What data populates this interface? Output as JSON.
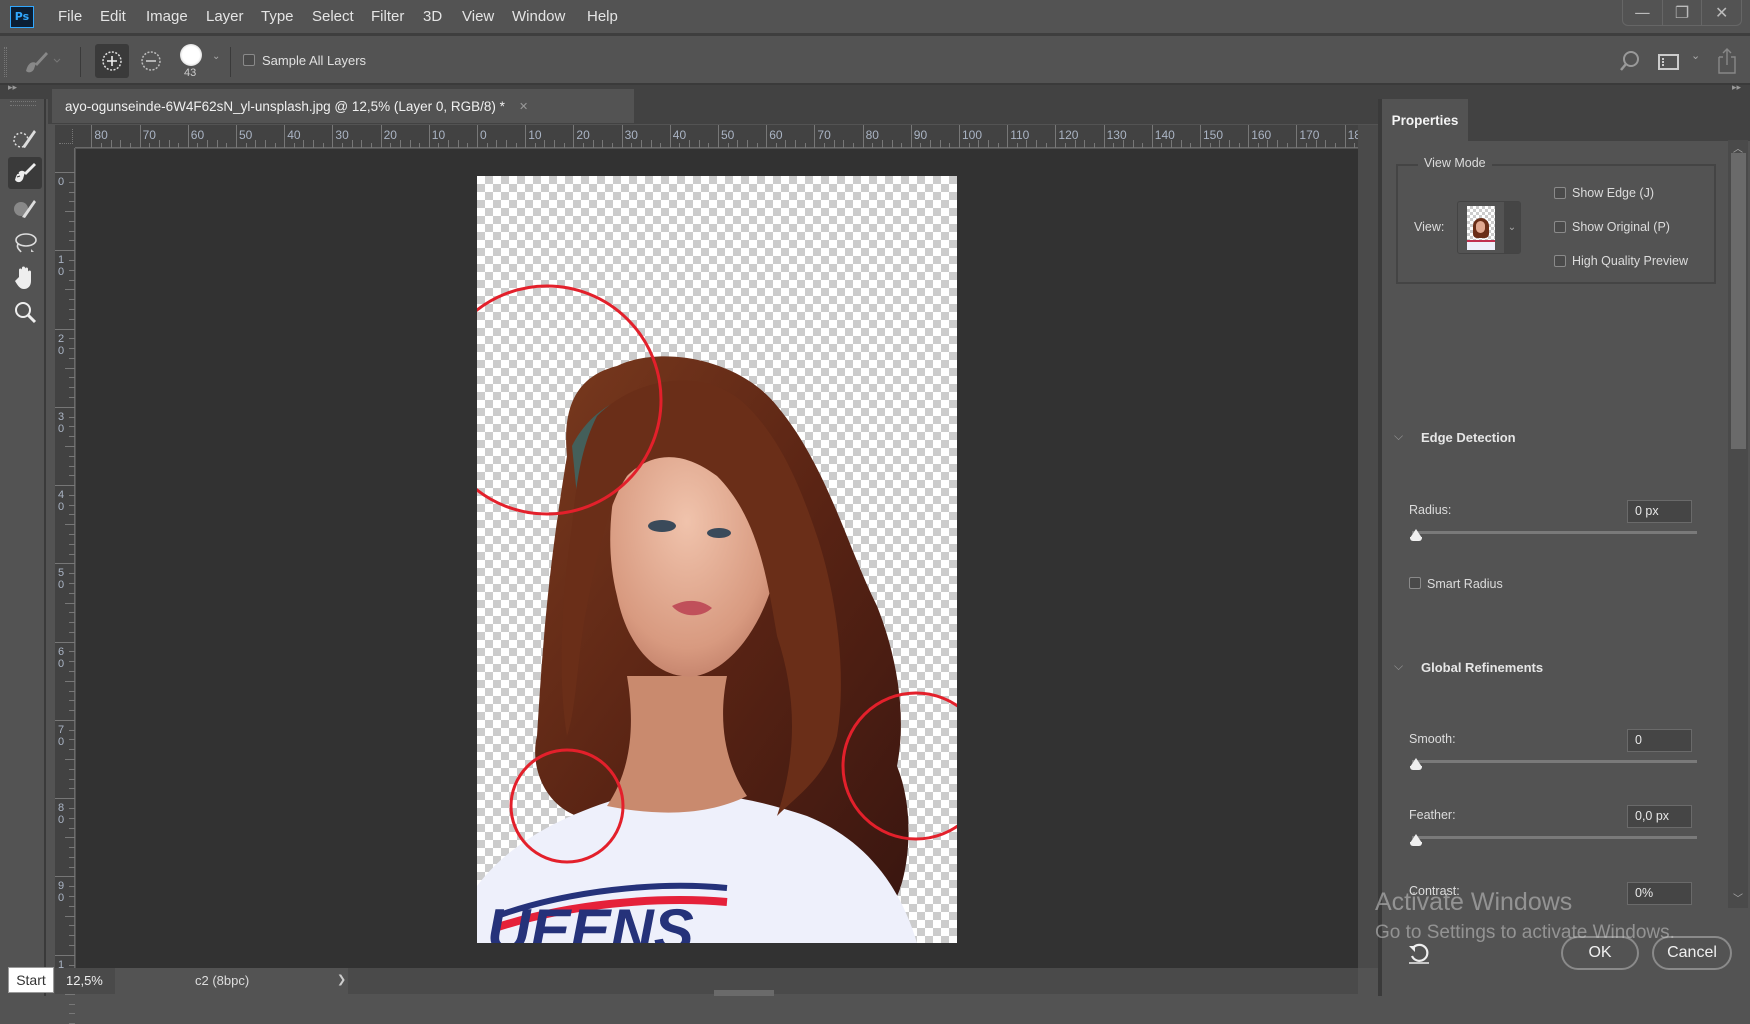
{
  "app": {
    "logo": "Ps"
  },
  "menu": [
    "File",
    "Edit",
    "Image",
    "Layer",
    "Type",
    "Select",
    "Filter",
    "3D",
    "View",
    "Window",
    "Help"
  ],
  "window_controls": {
    "minimize": "—",
    "restore": "❐",
    "close": "✕"
  },
  "options_bar": {
    "brush_size": "43",
    "sample_all_layers_label": "Sample All Layers",
    "sample_all_layers_checked": false
  },
  "document": {
    "tab_title": "ayo-ogunseinde-6W4F62sN_yl-unsplash.jpg @ 12,5% (Layer 0, RGB/8) *",
    "close_glyph": "✕",
    "ruler_h_labels": [
      "80",
      "70",
      "60",
      "50",
      "40",
      "30",
      "20",
      "10",
      "0",
      "10",
      "20",
      "30",
      "40",
      "50",
      "60",
      "70",
      "80",
      "90",
      "100",
      "110",
      "120",
      "130",
      "140",
      "150",
      "160",
      "170",
      "18"
    ],
    "ruler_v_labels": [
      "0",
      "10",
      "20",
      "30",
      "40",
      "50",
      "60",
      "70",
      "80",
      "90",
      "1"
    ]
  },
  "annotation_color": "#e3202b",
  "status": {
    "zoom": "12,5%",
    "info": "c2 (8bpc)",
    "arrow": "❯",
    "start_tooltip": "Start"
  },
  "properties": {
    "tab": "Properties",
    "view_mode": {
      "title": "View Mode",
      "view_label": "View:",
      "show_edge": "Show Edge (J)",
      "show_original": "Show Original (P)",
      "high_quality": "High Quality Preview"
    },
    "edge_detection": {
      "title": "Edge Detection",
      "radius_label": "Radius:",
      "radius_value": "0 px",
      "radius_fraction": 0,
      "smart_radius": "Smart Radius"
    },
    "global_refinements": {
      "title": "Global Refinements",
      "smooth_label": "Smooth:",
      "smooth_value": "0",
      "smooth_fraction": 0,
      "feather_label": "Feather:",
      "feather_value": "0,0 px",
      "feather_fraction": 0,
      "contrast_label": "Contrast:",
      "contrast_value": "0%"
    },
    "ok": "OK",
    "cancel": "Cancel"
  },
  "watermark": {
    "line1": "Activate Windows",
    "line2": "Go to Settings to activate Windows."
  }
}
